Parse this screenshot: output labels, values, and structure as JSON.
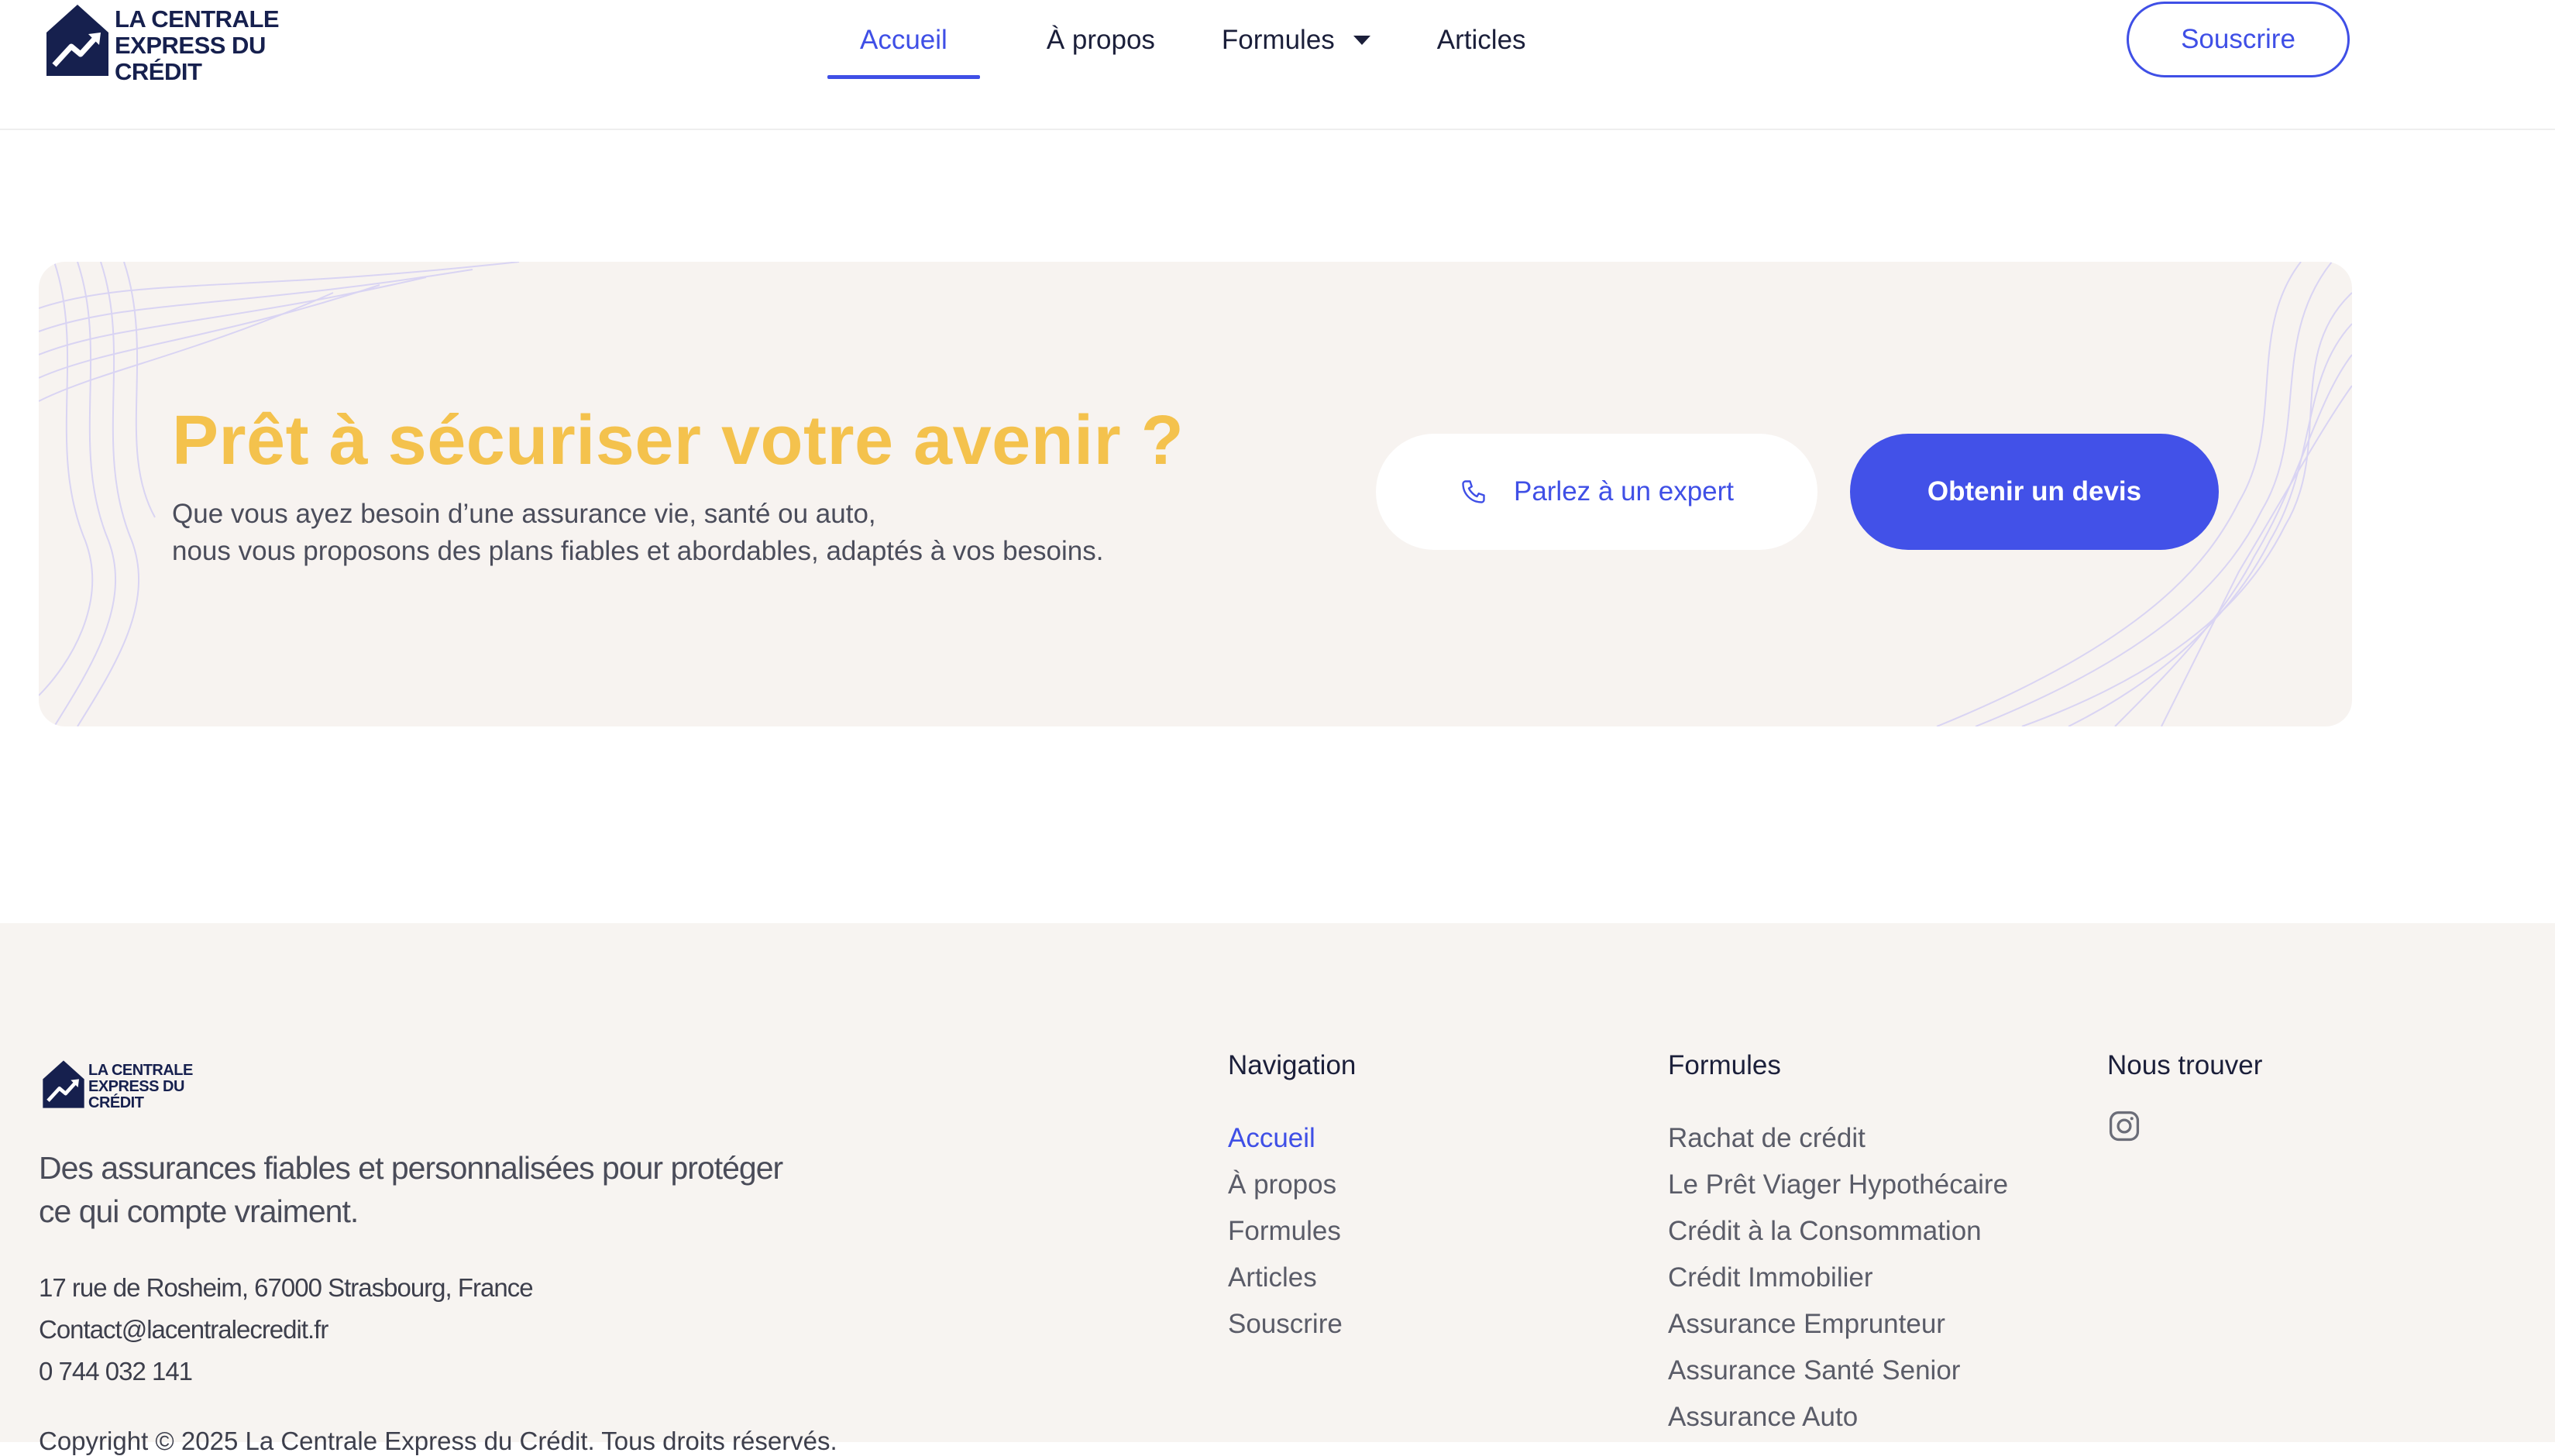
{
  "brand": {
    "line1": "LA CENTRALE",
    "line2": "EXPRESS DU",
    "line3": "CRÉDIT",
    "primary_color": "#16204e",
    "accent_color": "#3f4fe6",
    "highlight_color": "#f4c24d"
  },
  "header": {
    "nav": [
      {
        "label": "Accueil",
        "active": true
      },
      {
        "label": "À propos"
      },
      {
        "label": "Formules",
        "dropdown": true
      },
      {
        "label": "Articles"
      }
    ],
    "subscribe_label": "Souscrire"
  },
  "cta": {
    "title": "Prêt à sécuriser votre avenir ?",
    "desc_line1": "Que vous ayez besoin d’une assurance vie, santé ou auto,",
    "desc_line2": "nous vous proposons des plans fiables et abordables, adaptés à vos besoins.",
    "expert_label": "Parlez à un expert",
    "expert_icon": "phone-icon",
    "quote_label": "Obtenir un devis"
  },
  "footer": {
    "tagline_line1": "Des assurances fiables et personnalisées pour protéger",
    "tagline_line2": "ce qui compte vraiment.",
    "address": "17 rue de Rosheim, 67000 Strasbourg, France",
    "email": "Contact@lacentralecredit.fr",
    "phone": "0 744 032 141",
    "copyright": "Copyright © 2025 La Centrale Express du Crédit. Tous droits réservés.",
    "navigation": {
      "title": "Navigation",
      "links": [
        "Accueil",
        "À propos",
        "Formules",
        "Articles",
        "Souscrire"
      ]
    },
    "formules": {
      "title": "Formules",
      "links": [
        "Rachat de crédit",
        "Le Prêt Viager Hypothécaire",
        "Crédit à la Consommation",
        "Crédit Immobilier",
        "Assurance Emprunteur",
        "Assurance Santé Senior",
        "Assurance Auto"
      ]
    },
    "find_us": {
      "title": "Nous trouver",
      "icon": "instagram-icon"
    }
  }
}
